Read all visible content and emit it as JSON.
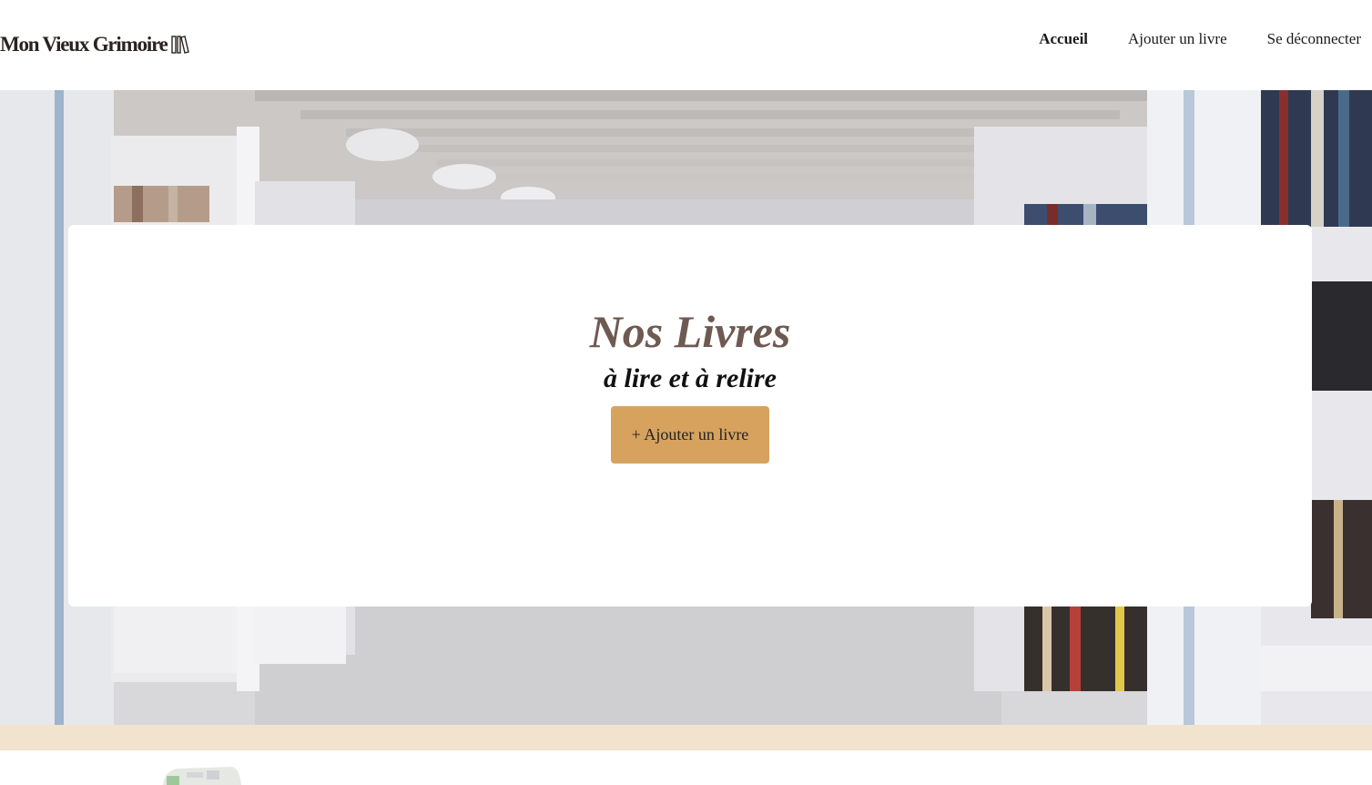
{
  "header": {
    "logo_text": "Mon Vieux Grimoire",
    "logo_icon": "books-icon",
    "nav": [
      {
        "label": "Accueil",
        "active": true
      },
      {
        "label": "Ajouter un livre",
        "active": false
      },
      {
        "label": "Se déconnecter",
        "active": false
      }
    ]
  },
  "hero": {
    "background": "library-shelves-photo",
    "title": "Nos Livres",
    "subtitle": "à lire et à relire",
    "add_button_label": "+ Ajouter un livre"
  },
  "colors": {
    "accent": "#d6a25e",
    "title": "#6e5a52",
    "band": "#f2e3cf"
  }
}
